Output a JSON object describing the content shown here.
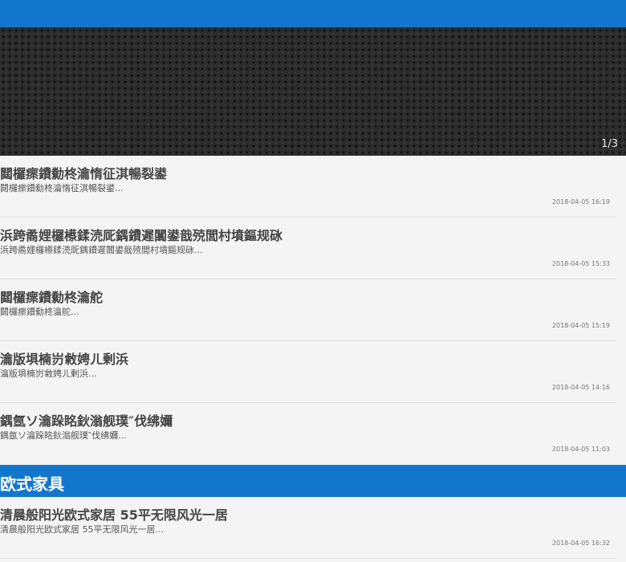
{
  "banner": {
    "counter": "1/3"
  },
  "news": [
    {
      "title": "閮欏瘝鐨勬柊瀹惰征淇暢裂鍙",
      "summary": "閮欏瘝鐨勬柊瀹惰征淇暢裂鍙...",
      "date": "2018-04-05 16:19"
    },
    {
      "title": "浜跨矞娌欏櫒鍒涜厑鍝鐨遲闒鍙戠殑閭村墳鏂规砯",
      "summary": "浜跨矞娌欏櫒鍒涜厑鍝鐨遲闒鍙戠殑閭村墳鏂规砯...",
      "date": "2018-04-05 15:33"
    },
    {
      "title": "閮欏瘝鐨勬柊瀹舵",
      "summary": "閮欏瘝鐨勬柊瀹舵...",
      "date": "2018-04-05 15:19"
    },
    {
      "title": "瀹版埧楠岃敹娉ㄦ剰浜",
      "summary": "瀹版埧楠岃敹娉ㄦ剰浜...",
      "date": "2018-04-05 14:16"
    },
    {
      "title": "鍝氬ソ瀹跺眳鈥滃舰璞″伐绋嬭",
      "summary": "鍝氬ソ瀹跺眳鈥滃舰璞″伐绋嬭...",
      "date": "2018-04-05 11:03"
    }
  ],
  "section": {
    "title": "欧式家具"
  },
  "section_items": [
    {
      "title": "清晨般阳光欧式家居 55平无限风光一居",
      "summary": "清晨般阳光欧式家居 55平无限风光一居...",
      "date": "2018-04-05 16:32"
    }
  ]
}
